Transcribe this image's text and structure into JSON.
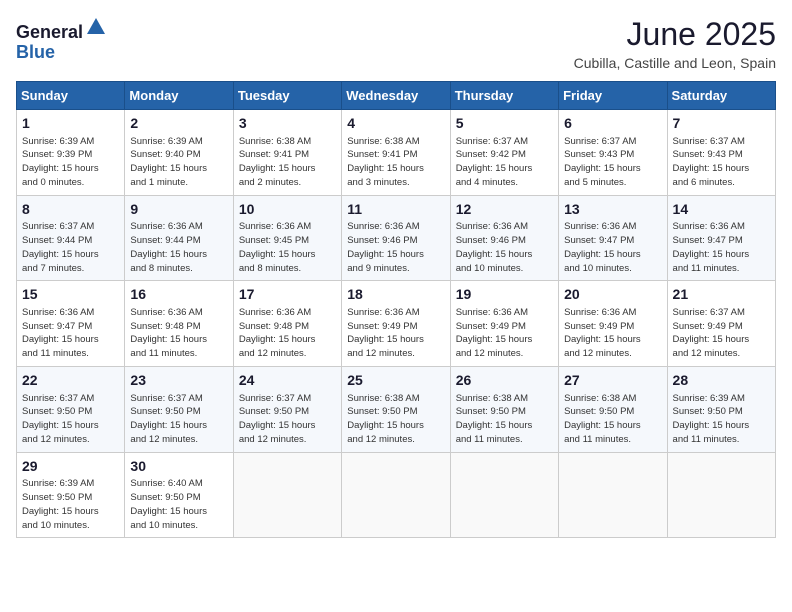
{
  "logo": {
    "general": "General",
    "blue": "Blue"
  },
  "header": {
    "month_title": "June 2025",
    "subtitle": "Cubilla, Castille and Leon, Spain"
  },
  "weekdays": [
    "Sunday",
    "Monday",
    "Tuesday",
    "Wednesday",
    "Thursday",
    "Friday",
    "Saturday"
  ],
  "weeks": [
    [
      {
        "day": "1",
        "sunrise": "6:39 AM",
        "sunset": "9:39 PM",
        "daylight": "15 hours and 0 minutes."
      },
      {
        "day": "2",
        "sunrise": "6:39 AM",
        "sunset": "9:40 PM",
        "daylight": "15 hours and 1 minute."
      },
      {
        "day": "3",
        "sunrise": "6:38 AM",
        "sunset": "9:41 PM",
        "daylight": "15 hours and 2 minutes."
      },
      {
        "day": "4",
        "sunrise": "6:38 AM",
        "sunset": "9:41 PM",
        "daylight": "15 hours and 3 minutes."
      },
      {
        "day": "5",
        "sunrise": "6:37 AM",
        "sunset": "9:42 PM",
        "daylight": "15 hours and 4 minutes."
      },
      {
        "day": "6",
        "sunrise": "6:37 AM",
        "sunset": "9:43 PM",
        "daylight": "15 hours and 5 minutes."
      },
      {
        "day": "7",
        "sunrise": "6:37 AM",
        "sunset": "9:43 PM",
        "daylight": "15 hours and 6 minutes."
      }
    ],
    [
      {
        "day": "8",
        "sunrise": "6:37 AM",
        "sunset": "9:44 PM",
        "daylight": "15 hours and 7 minutes."
      },
      {
        "day": "9",
        "sunrise": "6:36 AM",
        "sunset": "9:44 PM",
        "daylight": "15 hours and 8 minutes."
      },
      {
        "day": "10",
        "sunrise": "6:36 AM",
        "sunset": "9:45 PM",
        "daylight": "15 hours and 8 minutes."
      },
      {
        "day": "11",
        "sunrise": "6:36 AM",
        "sunset": "9:46 PM",
        "daylight": "15 hours and 9 minutes."
      },
      {
        "day": "12",
        "sunrise": "6:36 AM",
        "sunset": "9:46 PM",
        "daylight": "15 hours and 10 minutes."
      },
      {
        "day": "13",
        "sunrise": "6:36 AM",
        "sunset": "9:47 PM",
        "daylight": "15 hours and 10 minutes."
      },
      {
        "day": "14",
        "sunrise": "6:36 AM",
        "sunset": "9:47 PM",
        "daylight": "15 hours and 11 minutes."
      }
    ],
    [
      {
        "day": "15",
        "sunrise": "6:36 AM",
        "sunset": "9:47 PM",
        "daylight": "15 hours and 11 minutes."
      },
      {
        "day": "16",
        "sunrise": "6:36 AM",
        "sunset": "9:48 PM",
        "daylight": "15 hours and 11 minutes."
      },
      {
        "day": "17",
        "sunrise": "6:36 AM",
        "sunset": "9:48 PM",
        "daylight": "15 hours and 12 minutes."
      },
      {
        "day": "18",
        "sunrise": "6:36 AM",
        "sunset": "9:49 PM",
        "daylight": "15 hours and 12 minutes."
      },
      {
        "day": "19",
        "sunrise": "6:36 AM",
        "sunset": "9:49 PM",
        "daylight": "15 hours and 12 minutes."
      },
      {
        "day": "20",
        "sunrise": "6:36 AM",
        "sunset": "9:49 PM",
        "daylight": "15 hours and 12 minutes."
      },
      {
        "day": "21",
        "sunrise": "6:37 AM",
        "sunset": "9:49 PM",
        "daylight": "15 hours and 12 minutes."
      }
    ],
    [
      {
        "day": "22",
        "sunrise": "6:37 AM",
        "sunset": "9:50 PM",
        "daylight": "15 hours and 12 minutes."
      },
      {
        "day": "23",
        "sunrise": "6:37 AM",
        "sunset": "9:50 PM",
        "daylight": "15 hours and 12 minutes."
      },
      {
        "day": "24",
        "sunrise": "6:37 AM",
        "sunset": "9:50 PM",
        "daylight": "15 hours and 12 minutes."
      },
      {
        "day": "25",
        "sunrise": "6:38 AM",
        "sunset": "9:50 PM",
        "daylight": "15 hours and 12 minutes."
      },
      {
        "day": "26",
        "sunrise": "6:38 AM",
        "sunset": "9:50 PM",
        "daylight": "15 hours and 11 minutes."
      },
      {
        "day": "27",
        "sunrise": "6:38 AM",
        "sunset": "9:50 PM",
        "daylight": "15 hours and 11 minutes."
      },
      {
        "day": "28",
        "sunrise": "6:39 AM",
        "sunset": "9:50 PM",
        "daylight": "15 hours and 11 minutes."
      }
    ],
    [
      {
        "day": "29",
        "sunrise": "6:39 AM",
        "sunset": "9:50 PM",
        "daylight": "15 hours and 10 minutes."
      },
      {
        "day": "30",
        "sunrise": "6:40 AM",
        "sunset": "9:50 PM",
        "daylight": "15 hours and 10 minutes."
      },
      null,
      null,
      null,
      null,
      null
    ]
  ],
  "labels": {
    "sunrise": "Sunrise:",
    "sunset": "Sunset:",
    "daylight": "Daylight hours"
  }
}
